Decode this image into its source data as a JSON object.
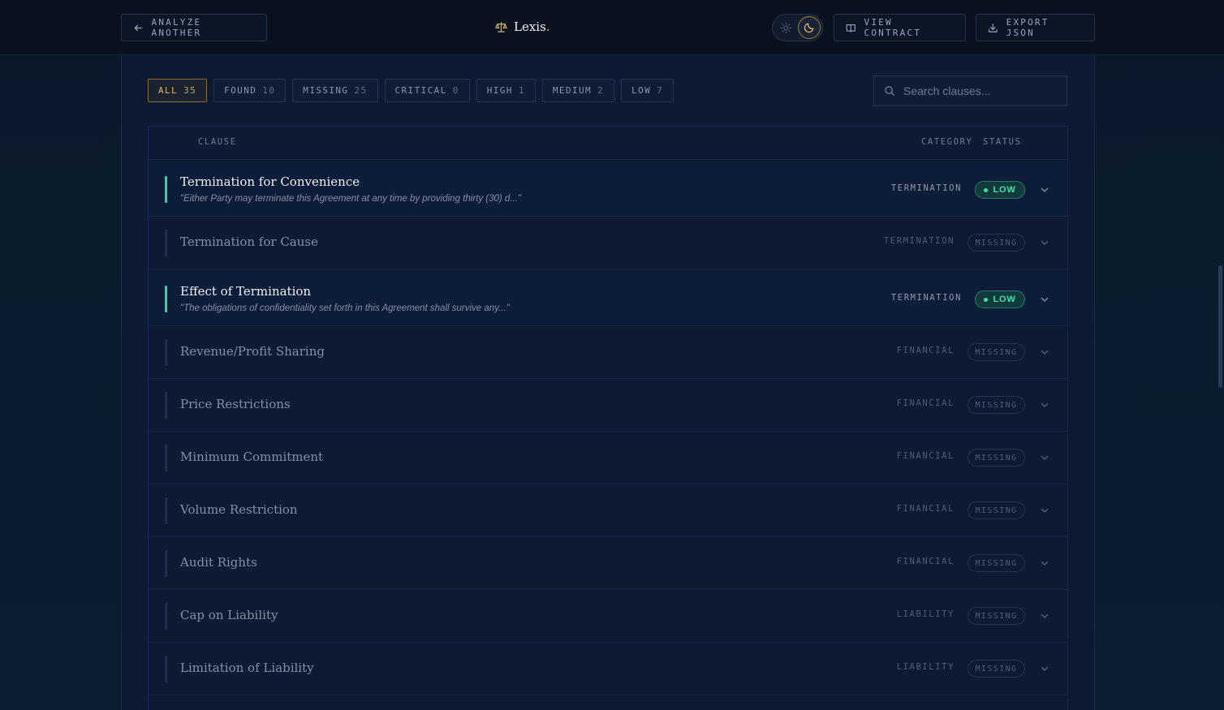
{
  "navbar": {
    "back_label": "ANALYZE ANOTHER",
    "logo_text": "Lexis",
    "logo_dot": ".",
    "view_contract_label": "VIEW CONTRACT",
    "export_label": "EXPORT JSON",
    "theme": "dark"
  },
  "filters": [
    {
      "label": "ALL",
      "count": "35",
      "active": true
    },
    {
      "label": "FOUND",
      "count": "10",
      "active": false
    },
    {
      "label": "MISSING",
      "count": "25",
      "active": false
    },
    {
      "label": "CRITICAL",
      "count": "0",
      "active": false
    },
    {
      "label": "HIGH",
      "count": "1",
      "active": false
    },
    {
      "label": "MEDIUM",
      "count": "2",
      "active": false
    },
    {
      "label": "LOW",
      "count": "7",
      "active": false
    }
  ],
  "search": {
    "placeholder": "Search clauses..."
  },
  "table": {
    "headers": {
      "clause": "CLAUSE",
      "category": "CATEGORY",
      "status": "STATUS"
    },
    "rows": [
      {
        "title": "Termination for Convenience",
        "quote": "\"Either Party may terminate this Agreement at any time by providing thirty (30) d...\"",
        "category": "TERMINATION",
        "status": "LOW",
        "found": true
      },
      {
        "title": "Termination for Cause",
        "quote": "",
        "category": "TERMINATION",
        "status": "MISSING",
        "found": false
      },
      {
        "title": "Effect of Termination",
        "quote": "\"The obligations of confidentiality set forth in this Agreement shall survive any...\"",
        "category": "TERMINATION",
        "status": "LOW",
        "found": true
      },
      {
        "title": "Revenue/Profit Sharing",
        "quote": "",
        "category": "FINANCIAL",
        "status": "MISSING",
        "found": false
      },
      {
        "title": "Price Restrictions",
        "quote": "",
        "category": "FINANCIAL",
        "status": "MISSING",
        "found": false
      },
      {
        "title": "Minimum Commitment",
        "quote": "",
        "category": "FINANCIAL",
        "status": "MISSING",
        "found": false
      },
      {
        "title": "Volume Restriction",
        "quote": "",
        "category": "FINANCIAL",
        "status": "MISSING",
        "found": false
      },
      {
        "title": "Audit Rights",
        "quote": "",
        "category": "FINANCIAL",
        "status": "MISSING",
        "found": false
      },
      {
        "title": "Cap on Liability",
        "quote": "",
        "category": "LIABILITY",
        "status": "MISSING",
        "found": false
      },
      {
        "title": "Limitation of Liability",
        "quote": "",
        "category": "LIABILITY",
        "status": "MISSING",
        "found": false
      }
    ]
  },
  "colors": {
    "accent_gold": "#dcb763",
    "low_green": "#3ee0a6",
    "background": "#0b1730"
  }
}
